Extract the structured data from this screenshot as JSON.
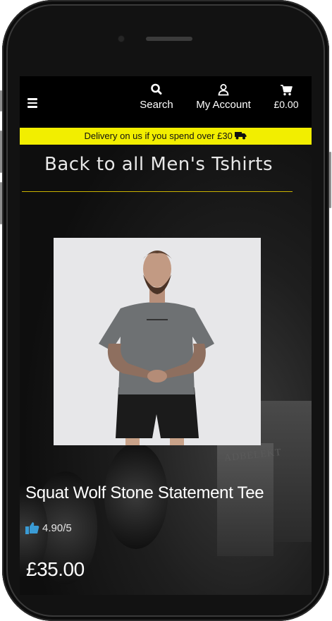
{
  "header": {
    "menu_icon": "hamburger-icon",
    "search_label": "Search",
    "account_label": "My Account",
    "cart_total": "£0.00"
  },
  "banner": {
    "text": "Delivery on us if you spend over £30",
    "icon": "truck-icon"
  },
  "nav": {
    "back_link": "Back to all Men's Tshirts"
  },
  "product": {
    "name": "Squat Wolf Stone Statement Tee",
    "rating": "4.90/5",
    "price": "£35.00"
  },
  "background": {
    "box_text": "ADBELEKT"
  },
  "colors": {
    "banner": "#f2ee00",
    "topbar": "#000000",
    "rating_icon": "#3a9bd5"
  }
}
